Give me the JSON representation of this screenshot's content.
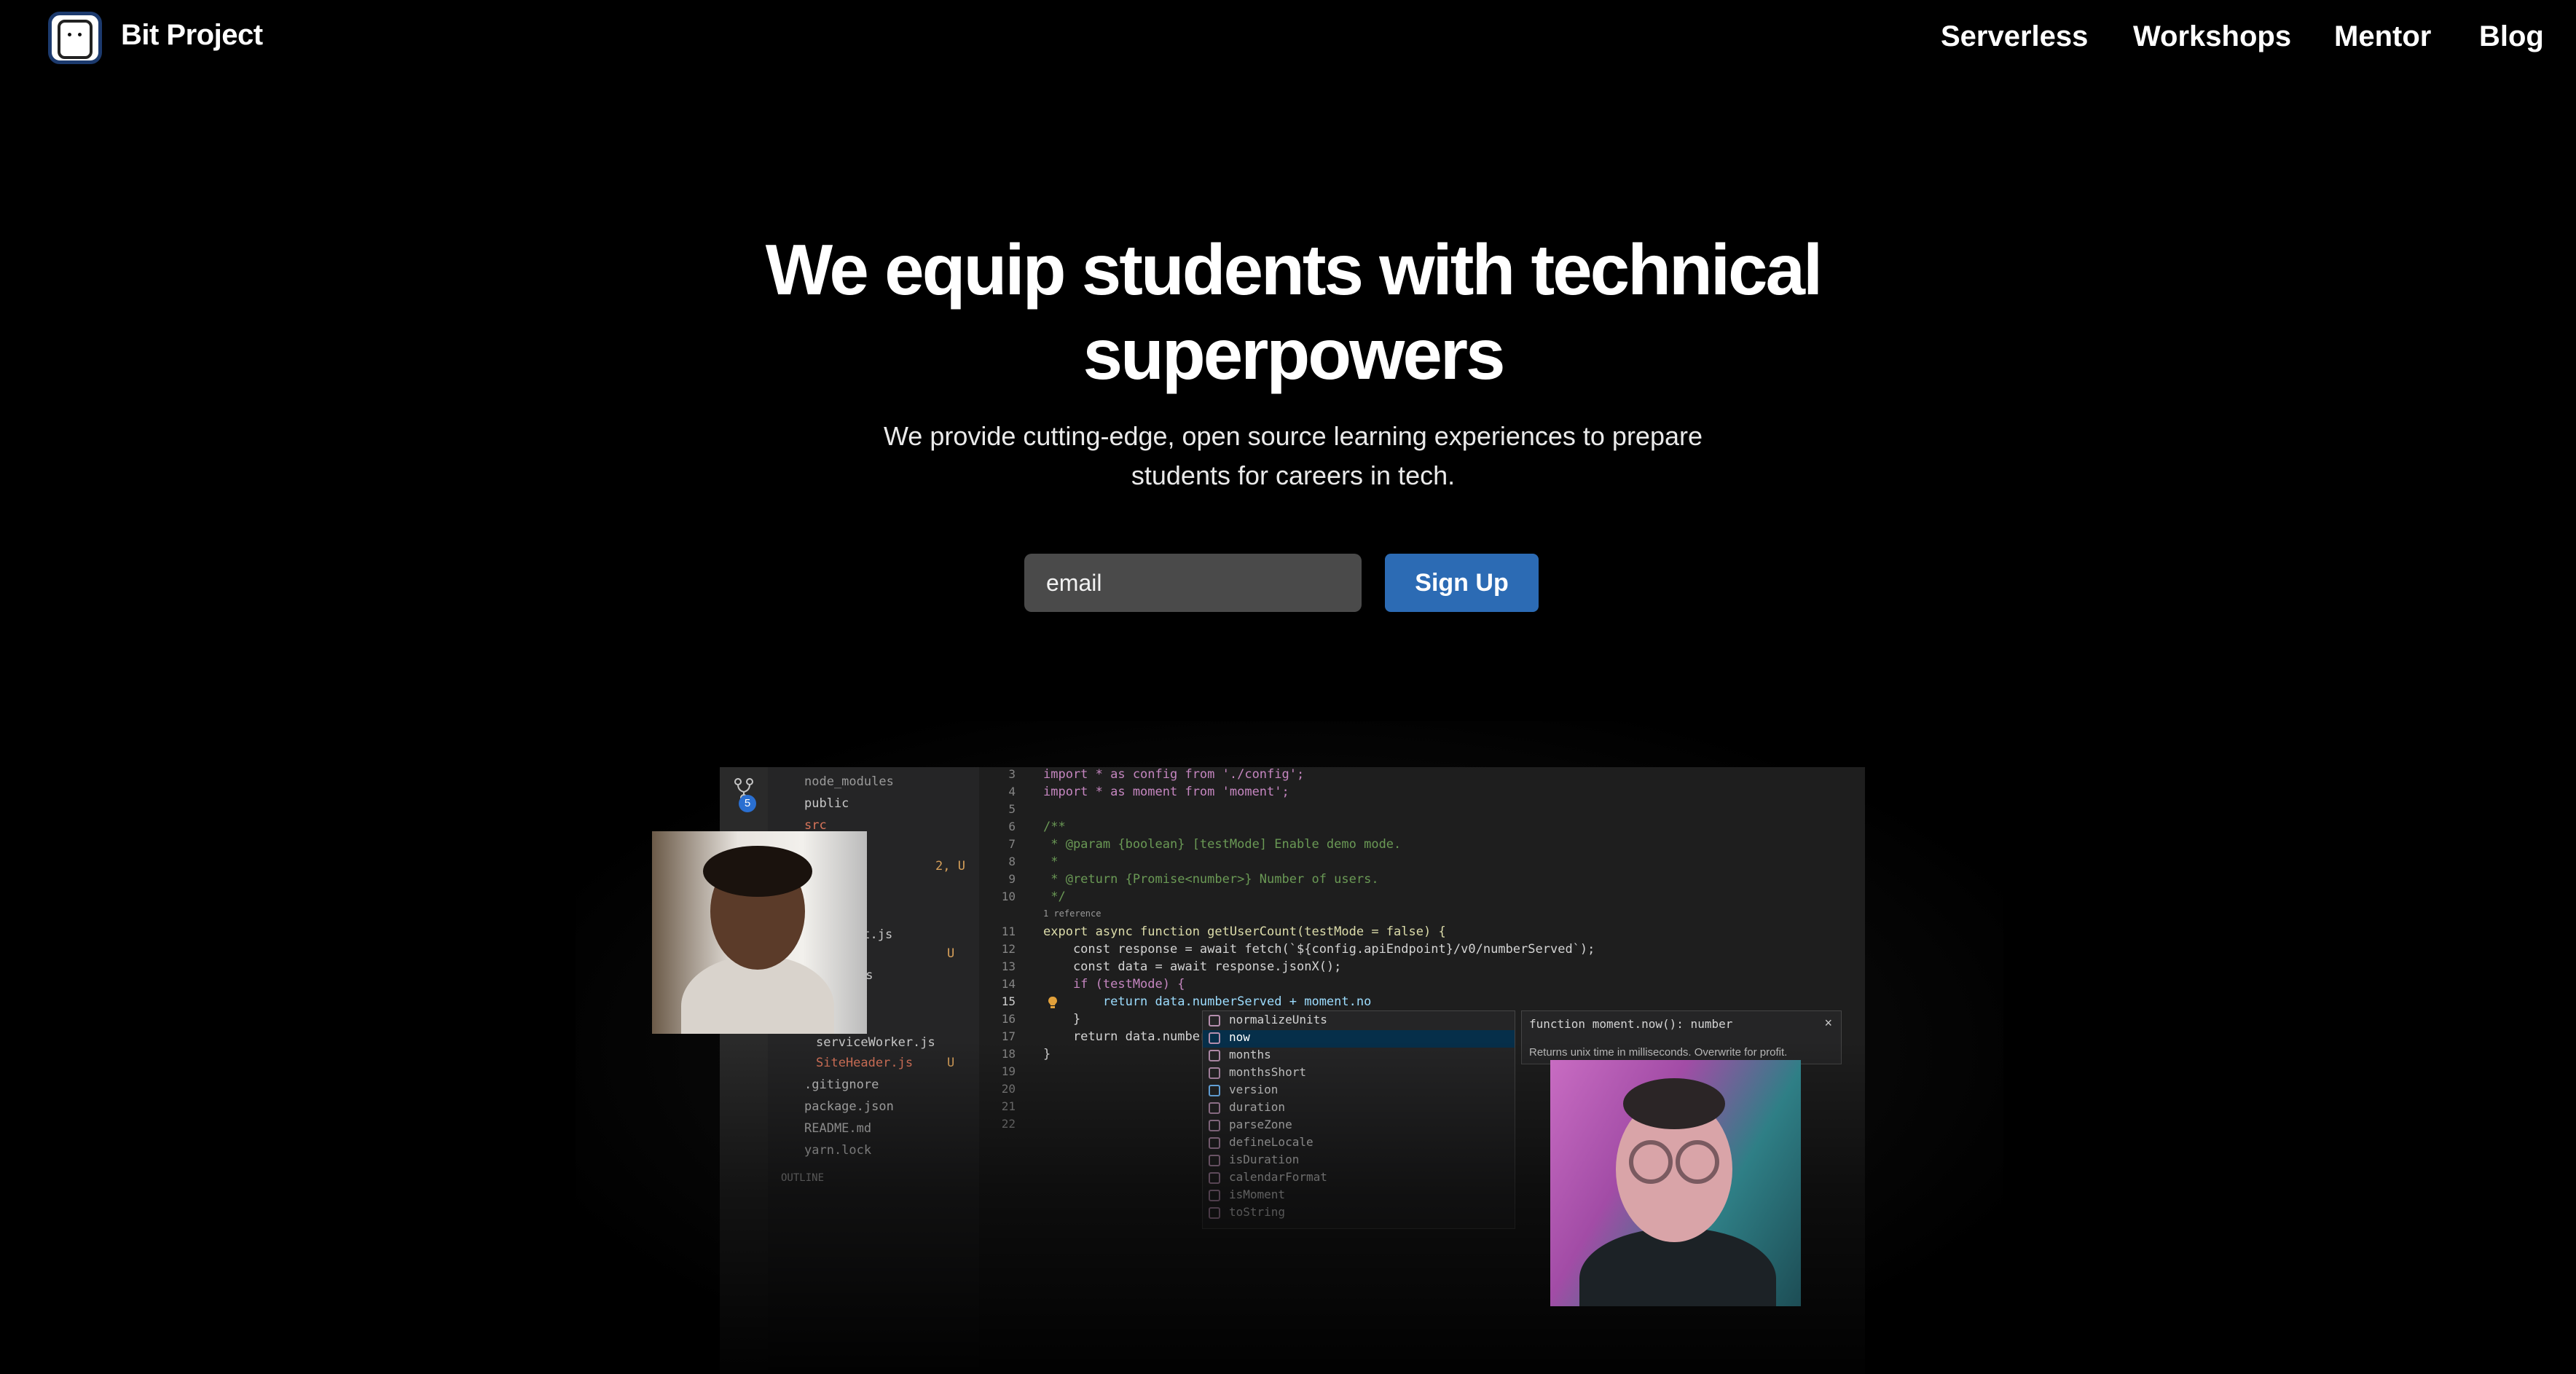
{
  "nav": {
    "brand": "Bit Project",
    "links": [
      "Serverless",
      "Workshops",
      "Mentor",
      "Blog"
    ]
  },
  "hero": {
    "title_line1": "We equip students with technical",
    "title_line2": "superpowers",
    "subtitle_line1": "We provide cutting-edge, open source learning experiences to prepare",
    "subtitle_line2": "students for careers in tech."
  },
  "signup_form": {
    "email_placeholder": "email",
    "button_label": "Sign Up"
  },
  "colors": {
    "background": "#000000",
    "primary_button": "#2c6bb4",
    "input_bg": "#4a4a4a"
  },
  "editor": {
    "git_badge": "5",
    "explorer": [
      "node_modules",
      "public",
      "src",
      "2, U",
      "it.js",
      "U",
      "ss",
      "serviceWorker.js",
      "SiteHeader.js",
      "U",
      ".gitignore",
      "package.json",
      "README.md",
      "yarn.lock",
      "OUTLINE"
    ],
    "line_numbers": [
      "3",
      "4",
      "5",
      "6",
      "7",
      "8",
      "9",
      "10",
      "11",
      "12",
      "13",
      "14",
      "15",
      "16",
      "17",
      "18",
      "19",
      "20",
      "21",
      "22"
    ],
    "code": [
      "import * as config from './config';",
      "import * as moment from 'moment';",
      "",
      "/**",
      " * @param {boolean} [testMode] Enable demo mode.",
      " *",
      " * @return {Promise<number>} Number of users.",
      " */",
      "1 reference",
      "export async function getUserCount(testMode = false) {",
      "    const response = await fetch(`${config.apiEndpoint}/v0/numberServed`);",
      "    const data = await response.jsonX();",
      "    if (testMode) {",
      "        return data.numberServed + moment.no",
      "    }",
      "    return data.number",
      "}"
    ],
    "autocomplete": [
      "normalizeUnits",
      "now",
      "months",
      "monthsShort",
      "version",
      "duration",
      "parseZone",
      "defineLocale",
      "isDuration",
      "calendarFormat",
      "isMoment",
      "toString"
    ],
    "detail_signature": "function moment.now(): number",
    "detail_doc": "Returns unix time in milliseconds. Overwrite for profit.",
    "detail_close": "×"
  }
}
